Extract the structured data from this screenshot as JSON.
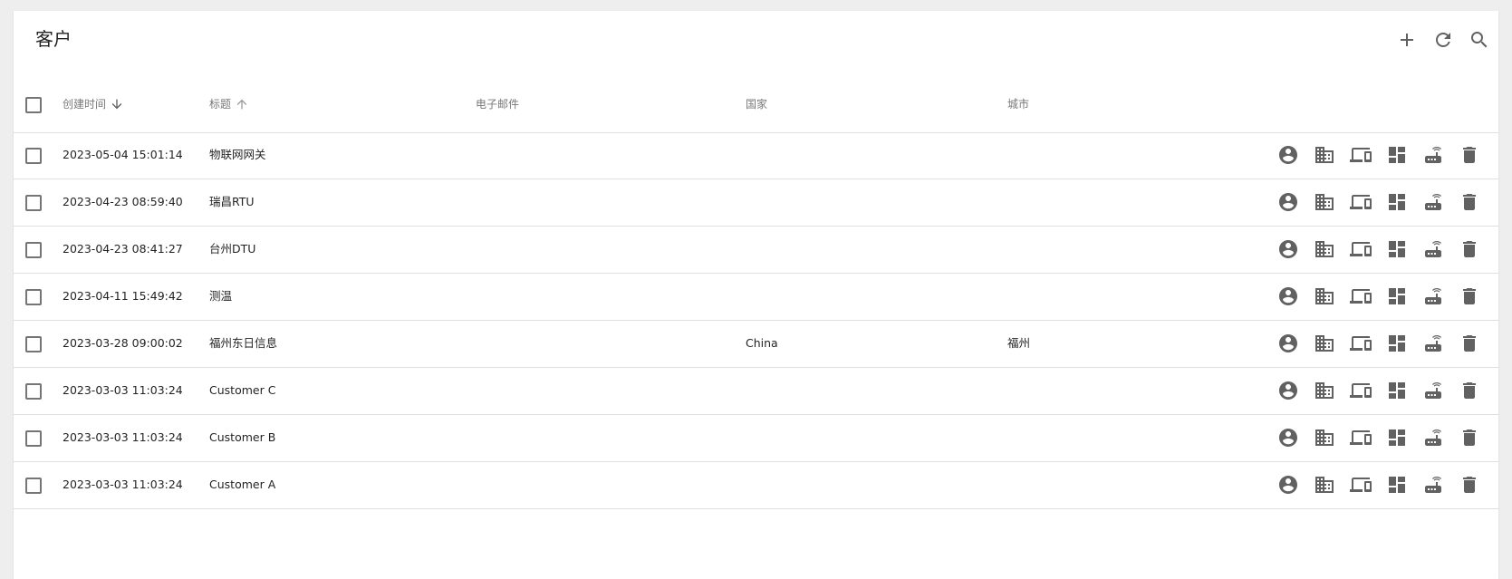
{
  "page": {
    "title": "客户"
  },
  "toolbar": {
    "icons": [
      "add-icon",
      "refresh-icon",
      "search-icon"
    ]
  },
  "table": {
    "columns": {
      "created": "创建时间",
      "title": "标题",
      "email": "电子邮件",
      "country": "国家",
      "city": "城市"
    },
    "sort": {
      "created": "descending",
      "title": "ascending"
    },
    "rows": [
      {
        "created": "2023-05-04 15:01:14",
        "title": "物联网网关",
        "email": "",
        "country": "",
        "city": ""
      },
      {
        "created": "2023-04-23 08:59:40",
        "title": "瑞昌RTU",
        "email": "",
        "country": "",
        "city": ""
      },
      {
        "created": "2023-04-23 08:41:27",
        "title": "台州DTU",
        "email": "",
        "country": "",
        "city": ""
      },
      {
        "created": "2023-04-11 15:49:42",
        "title": "测温",
        "email": "",
        "country": "",
        "city": ""
      },
      {
        "created": "2023-03-28 09:00:02",
        "title": "福州东日信息",
        "email": "",
        "country": "China",
        "city": "福州"
      },
      {
        "created": "2023-03-03 11:03:24",
        "title": "Customer C",
        "email": "",
        "country": "",
        "city": ""
      },
      {
        "created": "2023-03-03 11:03:24",
        "title": "Customer B",
        "email": "",
        "country": "",
        "city": ""
      },
      {
        "created": "2023-03-03 11:03:24",
        "title": "Customer A",
        "email": "",
        "country": "",
        "city": ""
      }
    ],
    "row_action_icons": [
      "account-circle-icon",
      "business-icon",
      "devices-icon",
      "dashboard-icon",
      "router-icon",
      "delete-icon"
    ]
  },
  "colors": {
    "background": "#eeeeee",
    "card": "#ffffff",
    "icon": "#616161",
    "divider": "#e0e0e0"
  }
}
